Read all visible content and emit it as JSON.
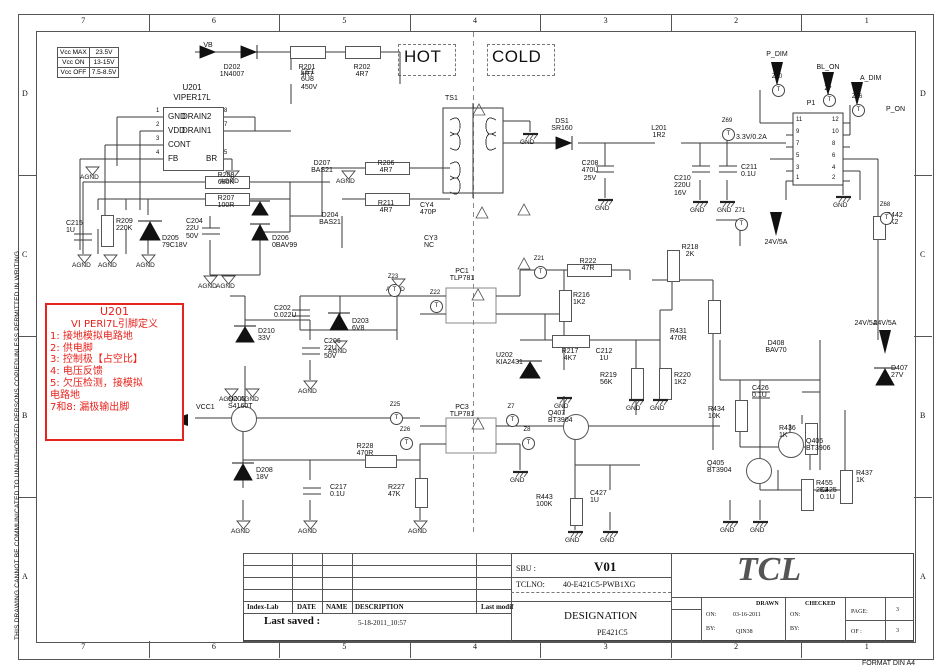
{
  "sheet": {
    "zone_cols": [
      "7",
      "6",
      "5",
      "4",
      "3",
      "2",
      "1"
    ],
    "zone_rows": [
      "D",
      "C",
      "B",
      "A"
    ],
    "side_notice": "THIS DRAWING CANNOT BE COMMUNICATED TO UNAUTHORIZED PERSONS COPIEDUNLESS  PERMITTED IN WRITING",
    "format": "FORMAT DIN A4"
  },
  "domains": {
    "hot": "HOT",
    "cold": "COLD"
  },
  "vcc_table": {
    "rows": [
      {
        "label": "Vcc MAX",
        "value": "23.5V"
      },
      {
        "label": "Vcc  ON",
        "value": "13-15V"
      },
      {
        "label": "Vcc OFF",
        "value": "7.5-8.5V"
      }
    ]
  },
  "u201": {
    "ref": "U201",
    "part": "VIPER17L",
    "pins_left": [
      {
        "num": "1",
        "name": "GND"
      },
      {
        "num": "2",
        "name": "VDD"
      },
      {
        "num": "3",
        "name": "CONT"
      },
      {
        "num": "4",
        "name": "FB"
      }
    ],
    "pins_right": [
      {
        "num": "8",
        "name": "DRAIN2"
      },
      {
        "num": "7",
        "name": "DRAIN1"
      },
      {
        "num": "5",
        "name": "BR"
      }
    ]
  },
  "note_box": {
    "title": "U201",
    "subtitle": "VI PERl7L引脚定义",
    "lines": [
      "1: 接地模拟电路地",
      "2: 供电脚",
      "3: 控制极【占空比】",
      "4: 电压反馈",
      "5: 欠压检测，接模拟",
      "电路地",
      "7和8: 漏极输出脚"
    ],
    "color": "#e8221c"
  },
  "components": [
    {
      "ref": "VB",
      "val": "",
      "name": "net-label-vb"
    },
    {
      "ref": "D202",
      "val": "1N4007",
      "name": "diode-d202"
    },
    {
      "ref": "CE1",
      "val": "6U8\n450V",
      "name": "cap-ce1"
    },
    {
      "ref": "R201",
      "val": "4R7",
      "name": "res-r201"
    },
    {
      "ref": "R202",
      "val": "4R7",
      "name": "res-r202"
    },
    {
      "ref": "D207",
      "val": "BAS21",
      "name": "diode-d207"
    },
    {
      "ref": "D204",
      "val": "BAS21",
      "name": "diode-d204"
    },
    {
      "ref": "R206",
      "val": "4R7",
      "name": "res-r206"
    },
    {
      "ref": "R211",
      "val": "4R7",
      "name": "res-r211"
    },
    {
      "ref": "R208",
      "val": "680K",
      "name": "res-r208"
    },
    {
      "ref": "R207",
      "val": "100R",
      "name": "res-r207"
    },
    {
      "ref": "C215",
      "val": "1U",
      "name": "cap-c215"
    },
    {
      "ref": "R209",
      "val": "220K",
      "name": "res-r209"
    },
    {
      "ref": "D205",
      "val": "79C18V",
      "name": "diode-d205"
    },
    {
      "ref": "C204",
      "val": "22U\n50V",
      "name": "cap-c204"
    },
    {
      "ref": "D206",
      "val": "0BAV99",
      "name": "diode-d206"
    },
    {
      "ref": "TS1",
      "val": "",
      "name": "transformer-ts1"
    },
    {
      "ref": "CY4",
      "val": "470P",
      "name": "cap-cy4"
    },
    {
      "ref": "CY3",
      "val": "NC",
      "name": "cap-cy3"
    },
    {
      "ref": "DS1",
      "val": "SR160",
      "name": "diode-ds1"
    },
    {
      "ref": "C208",
      "val": "470U\n25V",
      "name": "cap-c208"
    },
    {
      "ref": "L201",
      "val": "1R2",
      "name": "inductor-l201"
    },
    {
      "ref": "C210",
      "val": "220U\n16V",
      "name": "cap-c210"
    },
    {
      "ref": "C211",
      "val": "0.1U",
      "name": "cap-c211"
    },
    {
      "ref": "P1",
      "val": "",
      "name": "connector-p1"
    },
    {
      "ref": "R442",
      "val": "2K2",
      "name": "res-r442"
    },
    {
      "ref": "PC1",
      "val": "TLP781",
      "name": "opto-pc1"
    },
    {
      "ref": "PC3",
      "val": "TLP781",
      "name": "opto-pc3"
    },
    {
      "ref": "C202",
      "val": "0.022U",
      "name": "cap-c202"
    },
    {
      "ref": "D203",
      "val": "6V8",
      "name": "diode-d203"
    },
    {
      "ref": "C206",
      "val": "22U\n50V",
      "name": "cap-c206"
    },
    {
      "ref": "D210",
      "val": "33V",
      "name": "diode-d210"
    },
    {
      "ref": "R222",
      "val": "47R",
      "name": "res-r222"
    },
    {
      "ref": "R216",
      "val": "1K2",
      "name": "res-r216"
    },
    {
      "ref": "R218",
      "val": "2K",
      "name": "res-r218"
    },
    {
      "ref": "R217",
      "val": "4K7",
      "name": "res-r217"
    },
    {
      "ref": "C212",
      "val": "1U",
      "name": "cap-c212"
    },
    {
      "ref": "U202",
      "val": "KIA2431",
      "name": "shunt-u202"
    },
    {
      "ref": "R219",
      "val": "56K",
      "name": "res-r219"
    },
    {
      "ref": "R220",
      "val": "1K2",
      "name": "res-r220"
    },
    {
      "ref": "R431",
      "val": "470R",
      "name": "res-r431"
    },
    {
      "ref": "Q205",
      "val": "S4160T",
      "name": "transistor-q205"
    },
    {
      "ref": "D208",
      "val": "18V",
      "name": "diode-d208"
    },
    {
      "ref": "C217",
      "val": "0.1U",
      "name": "cap-c217"
    },
    {
      "ref": "R228",
      "val": "470R",
      "name": "res-r228"
    },
    {
      "ref": "R227",
      "val": "47K",
      "name": "res-r227"
    },
    {
      "ref": "Q407",
      "val": "BT3904",
      "name": "transistor-q407"
    },
    {
      "ref": "R443",
      "val": "100K",
      "name": "res-r443"
    },
    {
      "ref": "C427",
      "val": "1U",
      "name": "cap-c427"
    },
    {
      "ref": "R434",
      "val": "10K",
      "name": "res-r434"
    },
    {
      "ref": "C426",
      "val": "0.1U",
      "name": "cap-c426"
    },
    {
      "ref": "Q406",
      "val": "BT3906",
      "name": "transistor-q406"
    },
    {
      "ref": "Q405",
      "val": "BT3904",
      "name": "transistor-q405"
    },
    {
      "ref": "R455",
      "val": "2K2",
      "name": "res-r455"
    },
    {
      "ref": "R436",
      "val": "1K",
      "name": "res-r436"
    },
    {
      "ref": "C425",
      "val": "0.1U",
      "name": "cap-c425"
    },
    {
      "ref": "R437",
      "val": "1K",
      "name": "res-r437"
    },
    {
      "ref": "D407",
      "val": "27V",
      "name": "diode-d407"
    },
    {
      "ref": "D408",
      "val": "BAV70",
      "name": "diode-d408"
    }
  ],
  "nets": {
    "vb": "VB",
    "vcc1": "VCC1",
    "p_dim": "P_DIM",
    "bl_on": "BL_ON",
    "a_dim": "A_DIM",
    "p_on": "P_ON",
    "v33": "3.3V/0.2A",
    "v24a": "24V/5A",
    "v24b": "24V/5A",
    "v24c": "24V/5A",
    "gnd": "GND",
    "agnd": "AGND"
  },
  "testpoints": [
    "Z69",
    "Z70",
    "Z7",
    "Z66",
    "Z68",
    "Z71",
    "Z21",
    "Z22",
    "Z23",
    "Z25",
    "Z26",
    "Z7",
    "Z8"
  ],
  "p1_pins_left": [
    "11",
    "9",
    "7",
    "5",
    "3",
    "1"
  ],
  "p1_pins_right": [
    "12",
    "10",
    "8",
    "6",
    "4",
    "2"
  ],
  "titleblock": {
    "rev_cols": [
      "Index-Lab",
      "DATE",
      "NAME",
      "DESCRIPTION",
      "Last modif"
    ],
    "last_saved_label": "Last saved :",
    "last_saved_value": "5-18-2011_10:57",
    "sbu_label": "SBU :",
    "sbu_value": "V01",
    "tclno_label": "TCLNO:",
    "tclno_value": "40-E421C5-PWB1XG",
    "designation_label": "DESIGNATION",
    "designation_value": "PE421C5",
    "logo": "TCL",
    "drawn_label": "DRAWN",
    "drawn_on_label": "ON:",
    "drawn_on_value": "03-16-2011",
    "drawn_by_label": "BY:",
    "drawn_by_value": "QIN38",
    "checked_label": "CHECKED",
    "checked_on_label": "ON:",
    "checked_by_label": "BY:",
    "page_label": "PAGE:",
    "page_value": "3",
    "of_label": "OF :",
    "of_value": "3"
  }
}
